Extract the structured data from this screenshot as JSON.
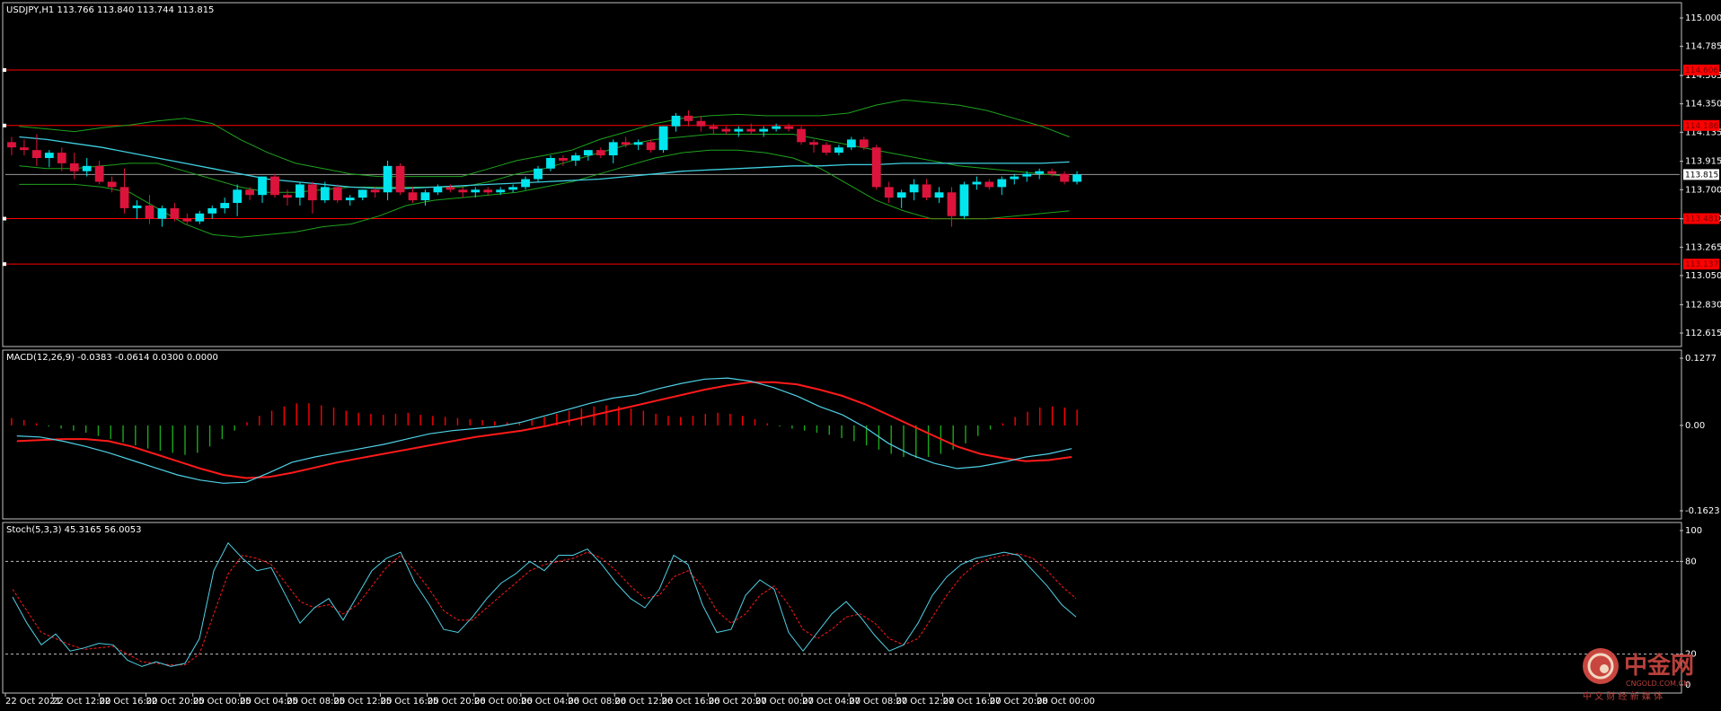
{
  "colors": {
    "background": "#000000",
    "frame": "#c0c0c0",
    "bull": "#00e5ee",
    "bear": "#dc143c",
    "level": "#ff0000",
    "bb": "#1ea31e",
    "ma": "#3ecfe0",
    "macd_main": "#4fd1e6",
    "macd_signal": "#ff1a1a",
    "hist_pos": "#ff0000",
    "hist_neg": "#1aa81a",
    "stoch_main": "#4fd1e6",
    "stoch_signal": "#ff1a1a",
    "watermark": "#b9403b"
  },
  "price_panel": {
    "header": "USDJPY,H1  113.766 113.840 113.744 113.815",
    "current_price_label": "113.815",
    "y_ticks": [
      "115.000",
      "114.785",
      "114.565",
      "114.350",
      "114.135",
      "113.915",
      "113.700",
      "113.480",
      "113.265",
      "113.050",
      "112.830",
      "112.615"
    ],
    "level_tags": [
      "114.606",
      "114.186",
      "113.481",
      "113.137"
    ]
  },
  "macd_panel": {
    "header": "MACD(12,26,9) -0.0383 -0.0614 0.0300 0.0000",
    "y_ticks": [
      "0.1277",
      "0.00",
      "-0.1623"
    ]
  },
  "stoch_panel": {
    "header": "Stoch(5,3,3) 45.3165 56.0053",
    "y_ticks": [
      "100",
      "80",
      "20",
      "0"
    ]
  },
  "time_axis": [
    "22 Oct 2021",
    "22 Oct 12:00",
    "22 Oct 16:00",
    "22 Oct 20:00",
    "25 Oct 00:00",
    "25 Oct 04:00",
    "25 Oct 08:00",
    "25 Oct 12:00",
    "25 Oct 16:00",
    "25 Oct 20:00",
    "26 Oct 00:00",
    "26 Oct 04:00",
    "26 Oct 08:00",
    "26 Oct 12:00",
    "26 Oct 16:00",
    "26 Oct 20:00",
    "27 Oct 00:00",
    "27 Oct 04:00",
    "27 Oct 08:00",
    "27 Oct 12:00",
    "27 Oct 16:00",
    "27 Oct 20:00",
    "28 Oct 00:00"
  ],
  "watermark": {
    "brand": "中金网",
    "url": "CNGOLD.COM.CN",
    "slogan": "中 文 财 经 新 媒 体"
  },
  "chart_data": [
    {
      "type": "candlestick",
      "symbol": "USDJPY",
      "timeframe": "H1",
      "ylim": [
        112.615,
        115.0
      ],
      "horizontal_levels": [
        114.606,
        114.186,
        113.481,
        113.137
      ],
      "last_price": 113.815,
      "ohlc": [
        [
          114.06,
          114.1,
          113.96,
          114.02
        ],
        [
          114.02,
          114.08,
          113.96,
          114.0
        ],
        [
          114.0,
          114.12,
          113.88,
          113.94
        ],
        [
          113.94,
          114.0,
          113.87,
          113.98
        ],
        [
          113.98,
          114.02,
          113.84,
          113.9
        ],
        [
          113.9,
          113.98,
          113.78,
          113.84
        ],
        [
          113.84,
          113.94,
          113.8,
          113.88
        ],
        [
          113.88,
          113.92,
          113.74,
          113.76
        ],
        [
          113.76,
          113.8,
          113.68,
          113.72
        ],
        [
          113.72,
          113.86,
          113.52,
          113.56
        ],
        [
          113.56,
          113.62,
          113.48,
          113.58
        ],
        [
          113.58,
          113.66,
          113.44,
          113.48
        ],
        [
          113.48,
          113.58,
          113.42,
          113.56
        ],
        [
          113.56,
          113.6,
          113.46,
          113.48
        ],
        [
          113.48,
          113.52,
          113.44,
          113.46
        ],
        [
          113.46,
          113.54,
          113.44,
          113.52
        ],
        [
          113.52,
          113.58,
          113.48,
          113.56
        ],
        [
          113.56,
          113.64,
          113.52,
          113.6
        ],
        [
          113.6,
          113.74,
          113.5,
          113.7
        ],
        [
          113.7,
          113.72,
          113.62,
          113.66
        ],
        [
          113.66,
          113.8,
          113.6,
          113.8
        ],
        [
          113.8,
          113.82,
          113.64,
          113.66
        ],
        [
          113.66,
          113.7,
          113.58,
          113.64
        ],
        [
          113.64,
          113.76,
          113.58,
          113.74
        ],
        [
          113.74,
          113.76,
          113.52,
          113.62
        ],
        [
          113.62,
          113.76,
          113.6,
          113.72
        ],
        [
          113.72,
          113.74,
          113.6,
          113.62
        ],
        [
          113.62,
          113.66,
          113.58,
          113.64
        ],
        [
          113.64,
          113.7,
          113.62,
          113.7
        ],
        [
          113.7,
          113.72,
          113.64,
          113.68
        ],
        [
          113.68,
          113.92,
          113.62,
          113.88
        ],
        [
          113.88,
          113.9,
          113.66,
          113.68
        ],
        [
          113.68,
          113.72,
          113.6,
          113.62
        ],
        [
          113.62,
          113.7,
          113.58,
          113.68
        ],
        [
          113.68,
          113.74,
          113.66,
          113.72
        ],
        [
          113.72,
          113.74,
          113.68,
          113.7
        ],
        [
          113.7,
          113.72,
          113.64,
          113.68
        ],
        [
          113.68,
          113.72,
          113.64,
          113.7
        ],
        [
          113.7,
          113.72,
          113.66,
          113.68
        ],
        [
          113.68,
          113.72,
          113.66,
          113.7
        ],
        [
          113.7,
          113.74,
          113.68,
          113.72
        ],
        [
          113.72,
          113.8,
          113.7,
          113.78
        ],
        [
          113.78,
          113.88,
          113.76,
          113.86
        ],
        [
          113.86,
          113.96,
          113.84,
          113.94
        ],
        [
          113.94,
          113.96,
          113.88,
          113.92
        ],
        [
          113.92,
          113.98,
          113.88,
          113.96
        ],
        [
          113.96,
          114.0,
          113.92,
          114.0
        ],
        [
          114.0,
          114.02,
          113.94,
          113.96
        ],
        [
          113.96,
          114.08,
          113.9,
          114.06
        ],
        [
          114.06,
          114.1,
          114.02,
          114.04
        ],
        [
          114.04,
          114.08,
          114.0,
          114.06
        ],
        [
          114.06,
          114.08,
          113.98,
          114.0
        ],
        [
          114.0,
          114.18,
          113.98,
          114.18
        ],
        [
          114.18,
          114.28,
          114.14,
          114.26
        ],
        [
          114.26,
          114.3,
          114.18,
          114.22
        ],
        [
          114.22,
          114.26,
          114.14,
          114.18
        ],
        [
          114.18,
          114.2,
          114.12,
          114.16
        ],
        [
          114.16,
          114.18,
          114.12,
          114.14
        ],
        [
          114.14,
          114.18,
          114.1,
          114.16
        ],
        [
          114.16,
          114.2,
          114.12,
          114.14
        ],
        [
          114.14,
          114.18,
          114.1,
          114.16
        ],
        [
          114.16,
          114.2,
          114.14,
          114.18
        ],
        [
          114.18,
          114.2,
          114.14,
          114.16
        ],
        [
          114.16,
          114.18,
          114.04,
          114.06
        ],
        [
          114.06,
          114.08,
          113.98,
          114.04
        ],
        [
          114.04,
          114.06,
          113.96,
          113.98
        ],
        [
          113.98,
          114.04,
          113.96,
          114.02
        ],
        [
          114.02,
          114.1,
          114.0,
          114.08
        ],
        [
          114.08,
          114.1,
          114.0,
          114.02
        ],
        [
          114.02,
          114.04,
          113.7,
          113.72
        ],
        [
          113.72,
          113.76,
          113.6,
          113.64
        ],
        [
          113.64,
          113.7,
          113.56,
          113.68
        ],
        [
          113.68,
          113.78,
          113.62,
          113.74
        ],
        [
          113.74,
          113.78,
          113.62,
          113.64
        ],
        [
          113.64,
          113.72,
          113.6,
          113.68
        ],
        [
          113.68,
          113.72,
          113.42,
          113.5
        ],
        [
          113.5,
          113.76,
          113.48,
          113.74
        ],
        [
          113.74,
          113.8,
          113.7,
          113.76
        ],
        [
          113.76,
          113.78,
          113.7,
          113.72
        ],
        [
          113.72,
          113.8,
          113.66,
          113.78
        ],
        [
          113.78,
          113.82,
          113.74,
          113.8
        ],
        [
          113.8,
          113.84,
          113.76,
          113.82
        ],
        [
          113.82,
          113.86,
          113.78,
          113.84
        ],
        [
          113.84,
          113.86,
          113.8,
          113.82
        ],
        [
          113.82,
          113.84,
          113.74,
          113.76
        ],
        [
          113.76,
          113.84,
          113.74,
          113.815
        ]
      ],
      "bollinger_upper": [
        114.18,
        114.16,
        114.14,
        114.17,
        114.19,
        114.22,
        114.24,
        114.2,
        114.08,
        113.98,
        113.9,
        113.86,
        113.82,
        113.8,
        113.8,
        113.8,
        113.8,
        113.86,
        113.92,
        113.96,
        114.0,
        114.08,
        114.14,
        114.2,
        114.24,
        114.26,
        114.27,
        114.26,
        114.26,
        114.26,
        114.28,
        114.34,
        114.38,
        114.36,
        114.34,
        114.3,
        114.24,
        114.18,
        114.1
      ],
      "bollinger_middle": [
        113.88,
        113.86,
        113.86,
        113.88,
        113.9,
        113.9,
        113.84,
        113.78,
        113.72,
        113.68,
        113.68,
        113.7,
        113.72,
        113.72,
        113.72,
        113.72,
        113.72,
        113.76,
        113.82,
        113.86,
        113.92,
        113.98,
        114.04,
        114.08,
        114.1,
        114.12,
        114.12,
        114.12,
        114.12,
        114.08,
        114.04,
        114.0,
        113.96,
        113.92,
        113.88,
        113.86,
        113.84,
        113.82,
        113.8
      ],
      "bollinger_lower": [
        113.74,
        113.74,
        113.74,
        113.72,
        113.68,
        113.56,
        113.44,
        113.36,
        113.34,
        113.36,
        113.38,
        113.42,
        113.44,
        113.5,
        113.58,
        113.62,
        113.64,
        113.66,
        113.68,
        113.72,
        113.76,
        113.82,
        113.88,
        113.94,
        113.98,
        114.0,
        114.0,
        113.98,
        113.94,
        113.86,
        113.74,
        113.62,
        113.54,
        113.48,
        113.48,
        113.48,
        113.5,
        113.52,
        113.54
      ],
      "moving_average": [
        114.1,
        114.08,
        114.05,
        114.02,
        113.98,
        113.94,
        113.9,
        113.86,
        113.82,
        113.78,
        113.76,
        113.74,
        113.72,
        113.71,
        113.71,
        113.72,
        113.73,
        113.74,
        113.75,
        113.76,
        113.77,
        113.78,
        113.8,
        113.82,
        113.84,
        113.85,
        113.86,
        113.87,
        113.88,
        113.88,
        113.89,
        113.89,
        113.9,
        113.9,
        113.9,
        113.9,
        113.9,
        113.9,
        113.91
      ]
    },
    {
      "type": "bar",
      "name": "MACD(12,26,9)",
      "ylim": [
        -0.1623,
        0.1277
      ],
      "histogram": [
        0.014,
        0.01,
        0.004,
        -0.002,
        -0.006,
        -0.01,
        -0.014,
        -0.02,
        -0.026,
        -0.032,
        -0.038,
        -0.044,
        -0.048,
        -0.052,
        -0.056,
        -0.052,
        -0.04,
        -0.026,
        -0.01,
        0.006,
        0.018,
        0.028,
        0.036,
        0.042,
        0.042,
        0.038,
        0.034,
        0.028,
        0.024,
        0.022,
        0.02,
        0.022,
        0.024,
        0.02,
        0.018,
        0.016,
        0.014,
        0.012,
        0.01,
        0.008,
        0.006,
        0.006,
        0.01,
        0.016,
        0.022,
        0.028,
        0.032,
        0.036,
        0.038,
        0.036,
        0.032,
        0.028,
        0.022,
        0.018,
        0.016,
        0.018,
        0.022,
        0.024,
        0.022,
        0.018,
        0.012,
        0.004,
        -0.002,
        -0.006,
        -0.01,
        -0.014,
        -0.018,
        -0.024,
        -0.03,
        -0.038,
        -0.046,
        -0.054,
        -0.06,
        -0.062,
        -0.06,
        -0.054,
        -0.046,
        -0.034,
        -0.02,
        -0.008,
        0.004,
        0.016,
        0.026,
        0.034,
        0.036,
        0.034,
        0.03
      ],
      "macd_main": [
        -0.02,
        -0.022,
        -0.03,
        -0.04,
        -0.052,
        -0.066,
        -0.08,
        -0.094,
        -0.104,
        -0.11,
        -0.108,
        -0.09,
        -0.07,
        -0.06,
        -0.052,
        -0.044,
        -0.036,
        -0.026,
        -0.016,
        -0.01,
        -0.006,
        -0.002,
        0.006,
        0.018,
        0.03,
        0.042,
        0.052,
        0.058,
        0.07,
        0.08,
        0.088,
        0.09,
        0.084,
        0.072,
        0.056,
        0.036,
        0.02,
        -0.004,
        -0.034,
        -0.056,
        -0.072,
        -0.082,
        -0.078,
        -0.07,
        -0.06,
        -0.054,
        -0.044
      ],
      "macd_signal": [
        -0.03,
        -0.028,
        -0.026,
        -0.026,
        -0.03,
        -0.04,
        -0.054,
        -0.068,
        -0.082,
        -0.094,
        -0.1,
        -0.098,
        -0.09,
        -0.08,
        -0.07,
        -0.062,
        -0.054,
        -0.046,
        -0.038,
        -0.03,
        -0.022,
        -0.016,
        -0.01,
        -0.002,
        0.008,
        0.018,
        0.028,
        0.038,
        0.048,
        0.058,
        0.068,
        0.076,
        0.082,
        0.082,
        0.078,
        0.068,
        0.056,
        0.04,
        0.02,
        0.0,
        -0.02,
        -0.04,
        -0.054,
        -0.062,
        -0.068,
        -0.066,
        -0.06
      ]
    },
    {
      "type": "line",
      "name": "Stoch(5,3,3)",
      "ylim": [
        0,
        100
      ],
      "levels": [
        80,
        20
      ],
      "main": [
        57,
        40,
        26,
        33,
        22,
        24,
        27,
        26,
        16,
        12,
        15,
        12,
        14,
        30,
        74,
        92,
        82,
        74,
        76,
        58,
        40,
        50,
        56,
        42,
        58,
        74,
        82,
        86,
        66,
        52,
        36,
        34,
        44,
        56,
        66,
        72,
        80,
        74,
        84,
        84,
        88,
        78,
        66,
        56,
        50,
        62,
        84,
        78,
        52,
        34,
        36,
        58,
        68,
        62,
        34,
        22,
        34,
        46,
        54,
        44,
        32,
        22,
        26,
        40,
        58,
        70,
        78,
        82,
        84,
        86,
        84,
        74,
        64,
        52,
        44
      ],
      "signal": [
        62,
        48,
        34,
        30,
        26,
        23,
        24,
        25,
        20,
        15,
        14,
        13,
        13,
        20,
        46,
        72,
        84,
        82,
        78,
        66,
        54,
        50,
        52,
        46,
        52,
        64,
        76,
        84,
        74,
        62,
        48,
        42,
        42,
        50,
        58,
        66,
        74,
        78,
        80,
        82,
        86,
        82,
        74,
        64,
        56,
        58,
        70,
        74,
        64,
        48,
        40,
        46,
        58,
        64,
        52,
        36,
        30,
        36,
        44,
        46,
        40,
        30,
        26,
        30,
        44,
        58,
        70,
        78,
        82,
        84,
        85,
        82,
        74,
        64,
        56
      ]
    }
  ]
}
